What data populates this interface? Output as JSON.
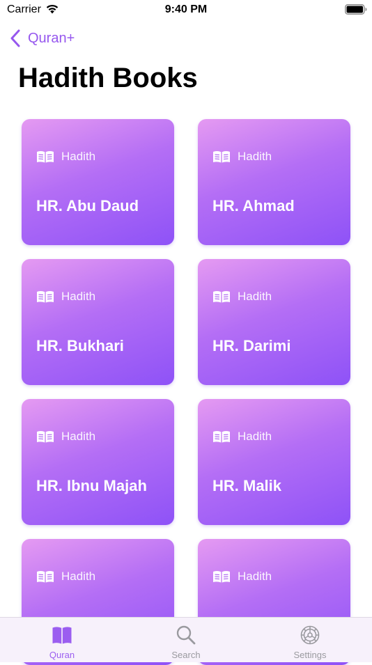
{
  "status_bar": {
    "carrier": "Carrier",
    "time": "9:40 PM"
  },
  "nav": {
    "back_label": "Quran+"
  },
  "page": {
    "title": "Hadith Books"
  },
  "cards": [
    {
      "tag": "Hadith",
      "title": "HR. Abu Daud"
    },
    {
      "tag": "Hadith",
      "title": "HR. Ahmad"
    },
    {
      "tag": "Hadith",
      "title": "HR. Bukhari"
    },
    {
      "tag": "Hadith",
      "title": "HR. Darimi"
    },
    {
      "tag": "Hadith",
      "title": "HR. Ibnu Majah"
    },
    {
      "tag": "Hadith",
      "title": "HR. Malik"
    },
    {
      "tag": "Hadith",
      "title": ""
    },
    {
      "tag": "Hadith",
      "title": ""
    }
  ],
  "tabs": [
    {
      "label": "Quran",
      "icon": "book-icon",
      "active": true
    },
    {
      "label": "Search",
      "icon": "search-icon",
      "active": false
    },
    {
      "label": "Settings",
      "icon": "gear-icon",
      "active": false
    }
  ],
  "colors": {
    "accent": "#9b5ef0",
    "card_gradient_start": "#e59af2",
    "card_gradient_end": "#8e52f7"
  }
}
